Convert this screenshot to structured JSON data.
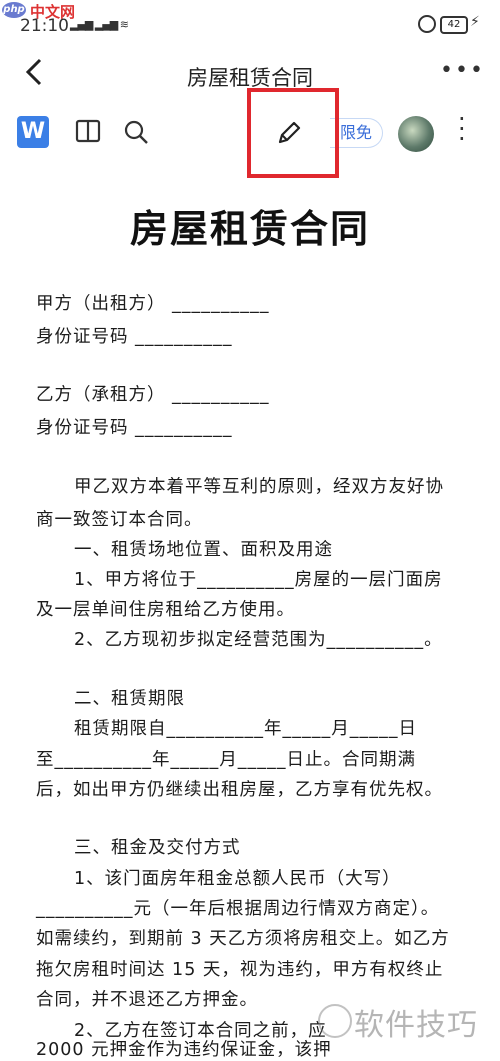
{
  "watermark_top": {
    "logo": "php",
    "text": "中文网"
  },
  "status_bar": {
    "time": "21:10",
    "signal": "▂▄▆ ▂▄▆ ≋",
    "battery": "42"
  },
  "header": {
    "title": "房屋租赁合同"
  },
  "toolbar": {
    "app_logo": "W",
    "badge": "限免"
  },
  "document": {
    "title": "房屋租赁合同",
    "lines": [
      "甲方（出租方） __________",
      "身份证号码 __________",
      "乙方（承租方） __________",
      "身份证号码 __________",
      "甲乙双方本着平等互利的原则，经双方友好协",
      "商一致签订本合同。",
      "一、租赁场地位置、面积及用途",
      "1、甲方将位于__________房屋的一层门面房",
      "及一层单间住房租给乙方使用。",
      "2、乙方现初步拟定经营范围为__________。",
      "二、租赁期限",
      "租赁期限自__________年_____月_____日",
      "至__________年_____月_____日止。合同期满",
      "后，如出甲方仍继续出租房屋，乙方享有优先权。",
      "三、租金及交付方式",
      "1、该门面房年租金总额人民币（大写）",
      "__________元（一年后根据周边行情双方商定）。",
      "如需续约，到期前 3 天乙方须将房租交上。如乙方",
      "拖欠房租时间达 15 天，视为违约，甲方有权终止",
      "合同，并不退还乙方押金。",
      "2、乙方在签订本合同之前，应",
      "2000 元押金作为违约保证金，该押"
    ]
  },
  "watermark_bottom": {
    "text": "软件技巧"
  }
}
